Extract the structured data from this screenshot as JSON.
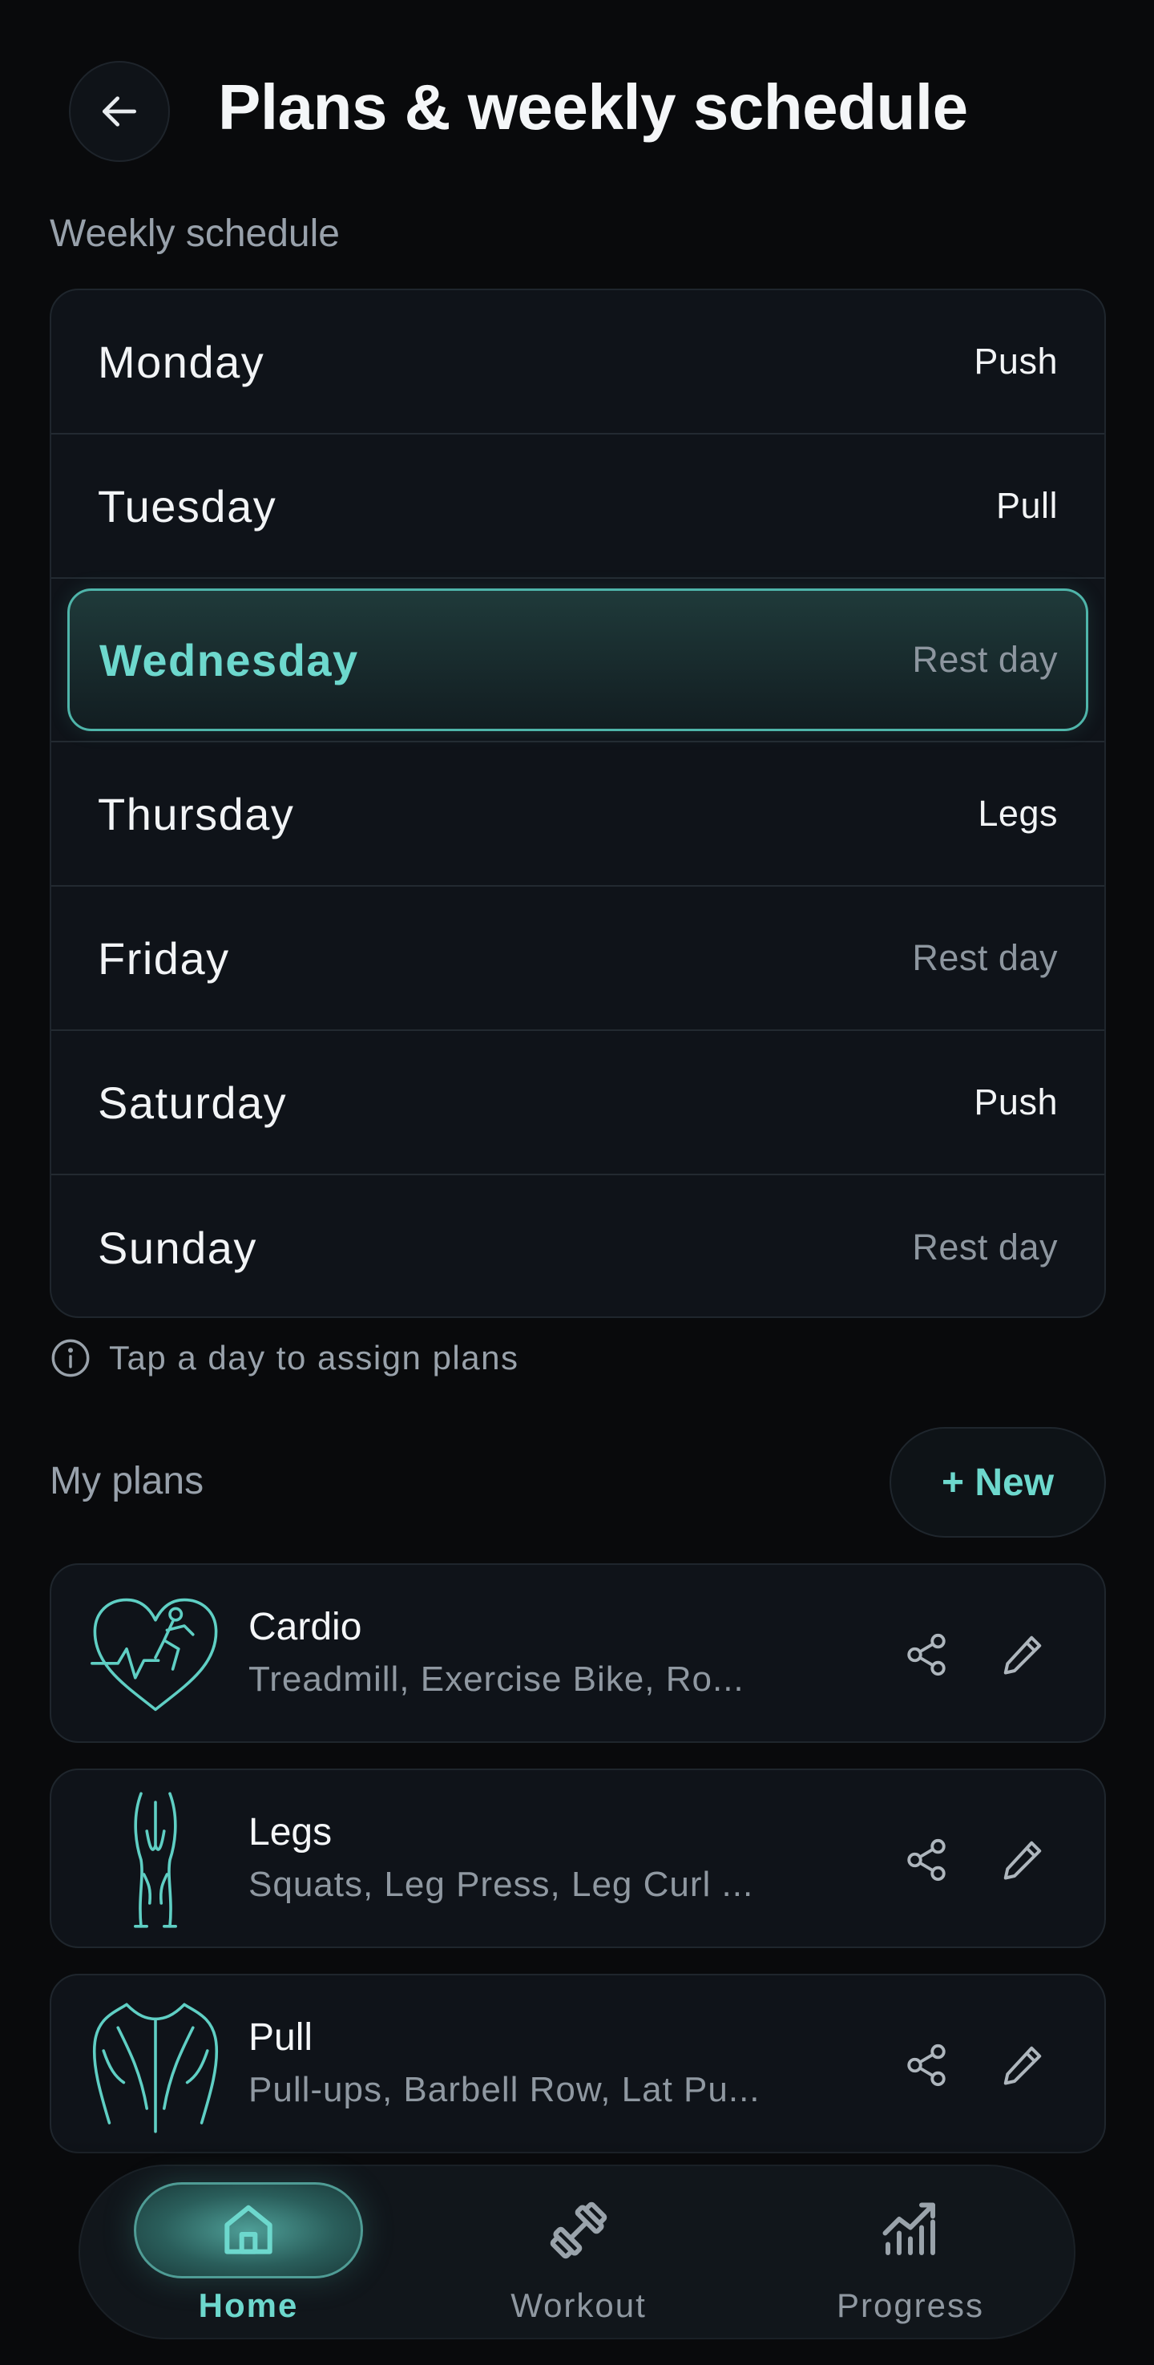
{
  "header": {
    "title": "Plans & weekly schedule",
    "back_icon": "arrow-left-icon"
  },
  "schedule": {
    "section_label": "Weekly schedule",
    "days": [
      {
        "day": "Monday",
        "plan": "Push",
        "rest": false,
        "selected": false
      },
      {
        "day": "Tuesday",
        "plan": "Pull",
        "rest": false,
        "selected": false
      },
      {
        "day": "Wednesday",
        "plan": "Rest day",
        "rest": true,
        "selected": true
      },
      {
        "day": "Thursday",
        "plan": "Legs",
        "rest": false,
        "selected": false
      },
      {
        "day": "Friday",
        "plan": "Rest day",
        "rest": true,
        "selected": false
      },
      {
        "day": "Saturday",
        "plan": "Push",
        "rest": false,
        "selected": false
      },
      {
        "day": "Sunday",
        "plan": "Rest day",
        "rest": true,
        "selected": false
      }
    ],
    "hint": "Tap a day to assign plans"
  },
  "plans": {
    "section_label": "My plans",
    "new_button": "+ New",
    "items": [
      {
        "name": "Cardio",
        "exercises": "Treadmill, Exercise Bike, Ro...",
        "thumb": "heart-runner-icon"
      },
      {
        "name": "Legs",
        "exercises": "Squats, Leg Press, Leg Curl ...",
        "thumb": "legs-muscle-icon"
      },
      {
        "name": "Pull",
        "exercises": "Pull-ups, Barbell Row, Lat Pu...",
        "thumb": "back-muscle-icon"
      }
    ]
  },
  "nav": {
    "items": [
      {
        "label": "Home",
        "icon": "home-icon",
        "active": true
      },
      {
        "label": "Workout",
        "icon": "dumbbell-icon",
        "active": false
      },
      {
        "label": "Progress",
        "icon": "chart-icon",
        "active": false
      }
    ]
  },
  "colors": {
    "accent": "#6dd8cd",
    "background": "#090a0c",
    "card": "#0f1319",
    "muted": "#8f98a1"
  }
}
